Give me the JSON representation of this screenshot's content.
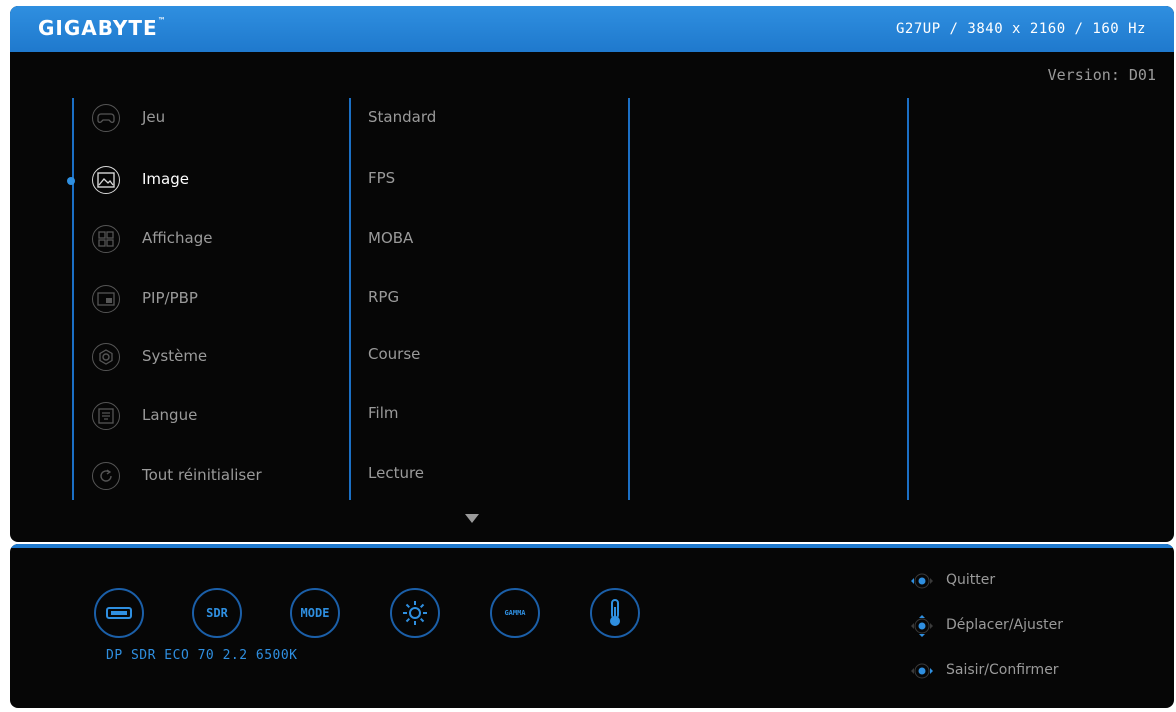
{
  "header": {
    "brand": "GIGABYTE",
    "brand_mark": "™",
    "model_info": "G27UP / 3840 x 2160 / 160 Hz"
  },
  "version": "Version: D01",
  "main_menu": [
    {
      "label": "Jeu",
      "icon": "gamepad-icon",
      "active": false
    },
    {
      "label": "Image",
      "icon": "picture-icon",
      "active": true
    },
    {
      "label": "Affichage",
      "icon": "display-grid-icon",
      "active": false
    },
    {
      "label": "PIP/PBP",
      "icon": "pip-icon",
      "active": false
    },
    {
      "label": "Système",
      "icon": "gear-icon",
      "active": false
    },
    {
      "label": "Langue",
      "icon": "language-icon",
      "active": false
    },
    {
      "label": "Tout réinitialiser",
      "icon": "reset-icon",
      "active": false
    }
  ],
  "sub_menu": [
    "Standard",
    "FPS",
    "MOBA",
    "RPG",
    "Course",
    "Film",
    "Lecture"
  ],
  "scroll_icon": "chevron-down-icon",
  "quick_icons": [
    {
      "icon": "input-port-icon",
      "label": ""
    },
    {
      "icon": "sdr-icon",
      "label": "SDR"
    },
    {
      "icon": "mode-icon",
      "label": "MODE"
    },
    {
      "icon": "brightness-icon",
      "label": ""
    },
    {
      "icon": "gamma-icon",
      "label": "GAMMA"
    },
    {
      "icon": "thermometer-icon",
      "label": ""
    }
  ],
  "status_line": "DP SDR ECO 70 2.2 6500K",
  "hints": [
    {
      "label": "Quitter",
      "icon": "joystick-left-icon"
    },
    {
      "label": "Déplacer/Ajuster",
      "icon": "joystick-updown-icon"
    },
    {
      "label": "Saisir/Confirmer",
      "icon": "joystick-right-icon"
    }
  ],
  "colors": {
    "accent": "#1f79cd",
    "background": "#060606",
    "text_inactive": "#9a9a9a",
    "text_active": "#ffffff"
  }
}
